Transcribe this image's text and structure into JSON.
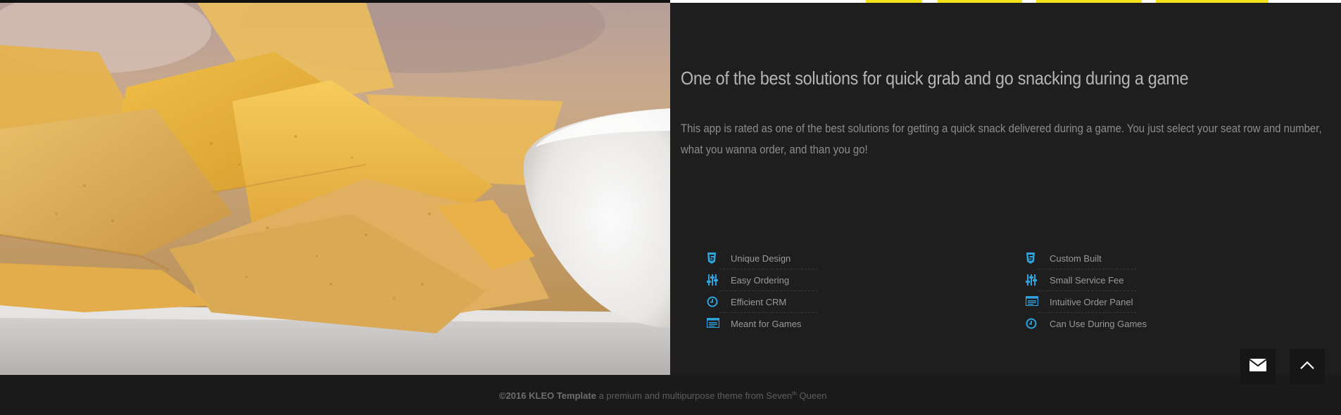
{
  "headline": "One of the best solutions for quick grab and go snacking during a game",
  "description": "This app is rated as one of the best solutions for getting a quick snack delivered during a game. You just select your seat row and number, what you wanna order, and than you go!",
  "features": {
    "left": [
      {
        "icon": "html5-shield-icon",
        "label": "Unique Design"
      },
      {
        "icon": "sliders-icon",
        "label": "Easy Ordering"
      },
      {
        "icon": "clock-icon",
        "label": "Efficient CRM"
      },
      {
        "icon": "browser-window-icon",
        "label": "Meant for Games"
      }
    ],
    "right": [
      {
        "icon": "html5-shield-icon",
        "label": "Custom Built"
      },
      {
        "icon": "sliders-icon",
        "label": "Small Service Fee"
      },
      {
        "icon": "browser-window-icon",
        "label": "Intuitive Order Panel"
      },
      {
        "icon": "clock-icon",
        "label": "Can Use During Games"
      }
    ]
  },
  "footer": {
    "copyright": "©2016 KLEO Template",
    "tagline": "a premium and multipurpose theme from Seven",
    "superscript": "th",
    "brand_end": "Queen"
  },
  "buttons": {
    "mail_icon": "envelope-icon",
    "up_icon": "chevron-up-icon"
  },
  "colors": {
    "accent": "#2fa3de",
    "background": "#1e1e1e",
    "footer": "#1a1a1a"
  }
}
